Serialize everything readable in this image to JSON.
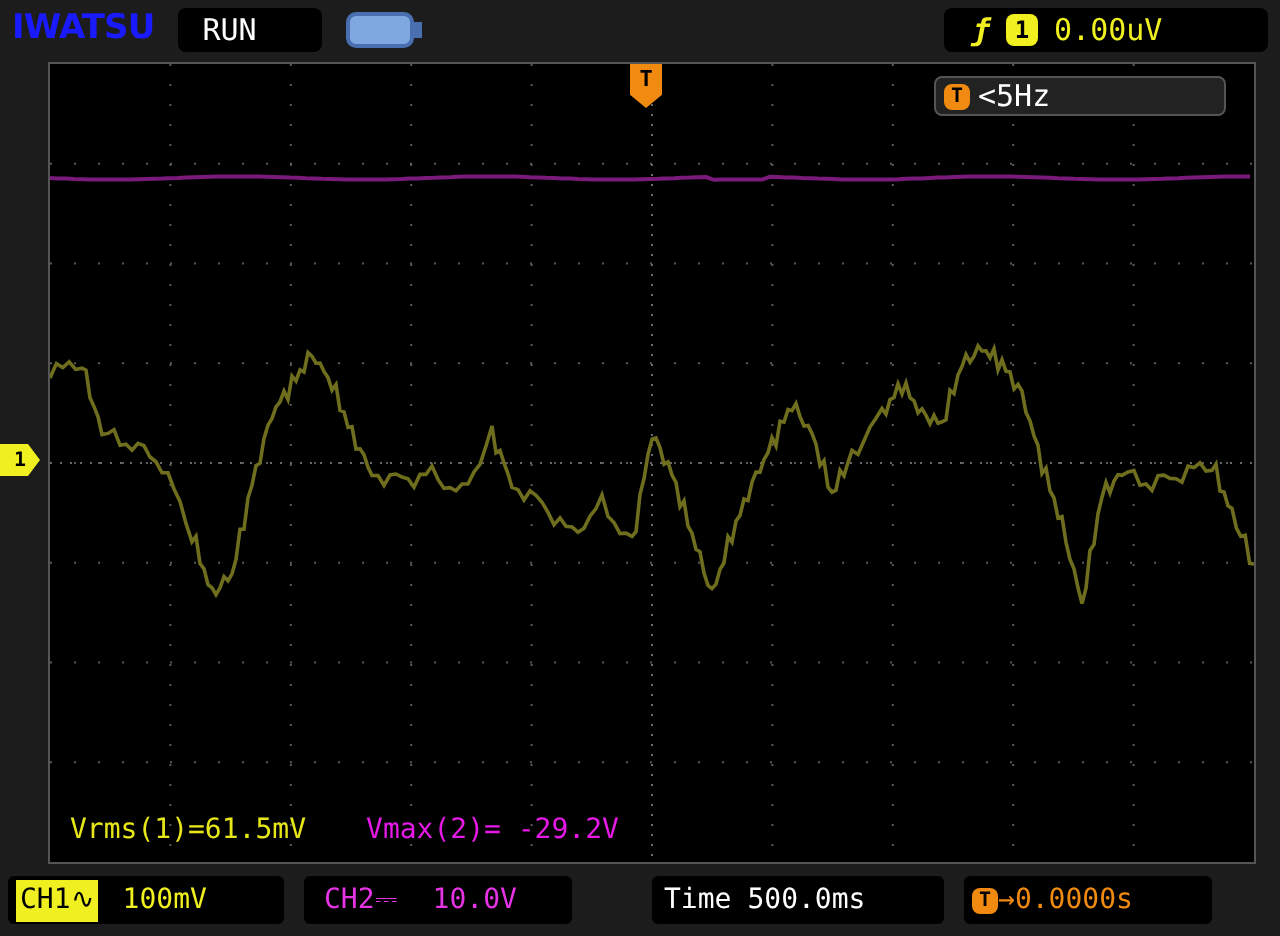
{
  "brand": "IWATSU",
  "run_state": "RUN",
  "trigger": {
    "slope_icon": "ƒ",
    "channel": "1",
    "level": "0.00uV"
  },
  "trigger_marker": "T",
  "trigger_frequency": {
    "badge": "T",
    "text": "<5Hz"
  },
  "channel_marker": "1",
  "measurements": [
    {
      "text": "Vrms(1)=61.5mV",
      "color": "#e6e619"
    },
    {
      "text": "Vmax(2)= -29.2V",
      "color": "#e619e6"
    }
  ],
  "channels": [
    {
      "label": "CH1",
      "coupling": "∿",
      "scale": "100mV",
      "color": "#f0f020"
    },
    {
      "label": "CH2",
      "coupling": "⎓",
      "scale": "10.0V",
      "color": "#e633e6"
    }
  ],
  "timebase": {
    "label": "Time",
    "value": "500.0ms"
  },
  "trigger_offset": {
    "badge": "T",
    "arrow": "→",
    "value": "0.0000s"
  }
}
